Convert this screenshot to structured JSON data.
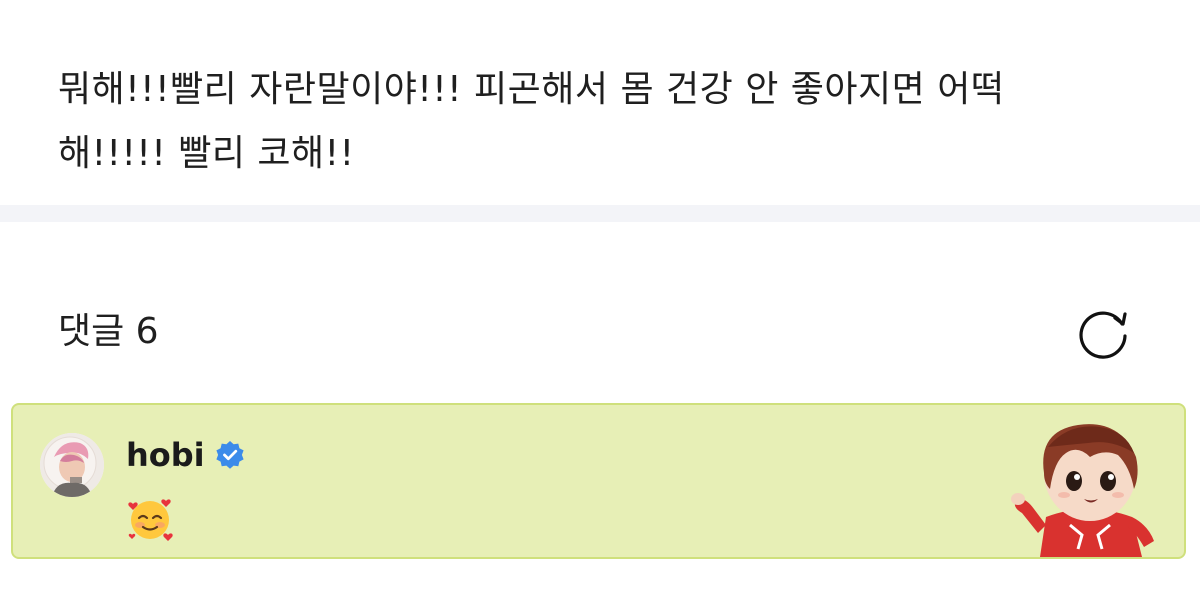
{
  "post": {
    "text": "뭐해!!!빨리 자란말이야!!! 피곤해서 몸 건강 안 좋아지면 어떡\n해!!!!! 빨리 코해!!"
  },
  "comments": {
    "title": "댓글 6",
    "refresh_icon": "refresh-icon",
    "items": [
      {
        "author": "hobi",
        "verified_icon": "verified-badge-icon",
        "avatar_icon": "avatar",
        "content_emoji_name": "smiling-face-with-hearts-emoji",
        "sticker_name": "character-sticker",
        "highlight_color": "#e7efb6",
        "border_color": "#cfe07c"
      }
    ]
  },
  "colors": {
    "divider": "#f3f4f8",
    "verified_blue": "#3b8bea",
    "text": "#1f1f1f"
  }
}
